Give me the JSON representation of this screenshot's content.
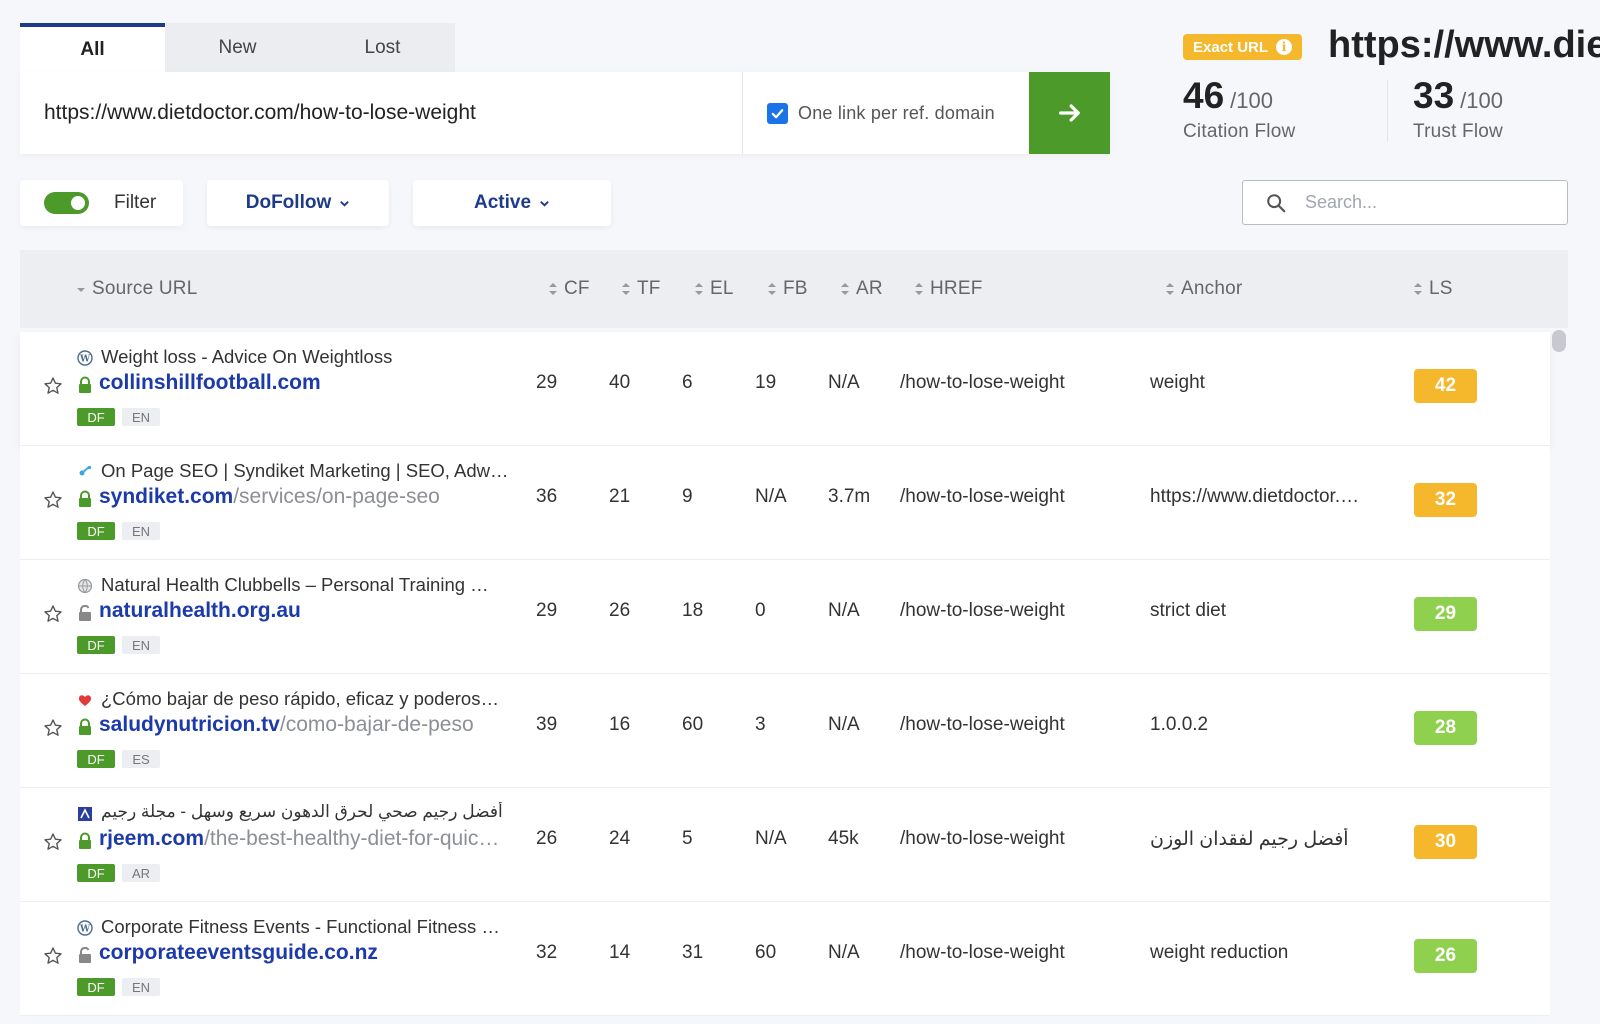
{
  "tabs": [
    {
      "label": "All",
      "active": true
    },
    {
      "label": "New",
      "active": false
    },
    {
      "label": "Lost",
      "active": false
    }
  ],
  "search_bar": {
    "url_value": "https://www.dietdoctor.com/how-to-lose-weight",
    "one_link_label": "One link per ref. domain",
    "one_link_checked": true
  },
  "header": {
    "exact_badge": "Exact URL",
    "target_url": "https://www.dietdoctor.com",
    "citation_flow": {
      "value": "46",
      "max": "/100",
      "label": "Citation Flow"
    },
    "trust_flow": {
      "value": "33",
      "max": "/100",
      "label": "Trust Flow"
    }
  },
  "filters": {
    "filter_label": "Filter",
    "filter_enabled": true,
    "dofollow_label": "DoFollow",
    "active_label": "Active",
    "search_placeholder": "Search..."
  },
  "table": {
    "columns": [
      "Source URL",
      "CF",
      "TF",
      "EL",
      "FB",
      "AR",
      "HREF",
      "Anchor",
      "LS"
    ],
    "rows": [
      {
        "icon": "wordpress-icon",
        "title": "Weight loss - Advice On Weightloss",
        "domain": "collinshillfootball.com",
        "path": "",
        "secure": true,
        "tag": "DF",
        "lang": "EN",
        "cf": "29",
        "tf": "40",
        "el": "6",
        "fb": "19",
        "ar": "N/A",
        "href": "/how-to-lose-weight",
        "anchor": "weight",
        "ls": "42",
        "ls_color": "#f5b72c"
      },
      {
        "icon": "link-icon",
        "title": "On Page SEO | Syndiket Marketing | SEO, Adw…",
        "domain": "syndiket.com",
        "path": "/services/on-page-seo",
        "secure": true,
        "tag": "DF",
        "lang": "EN",
        "cf": "36",
        "tf": "21",
        "el": "9",
        "fb": "N/A",
        "ar": "3.7m",
        "href": "/how-to-lose-weight",
        "anchor": "https://www.dietdoctor.…",
        "ls": "32",
        "ls_color": "#f5b72c"
      },
      {
        "icon": "globe-icon",
        "title": "Natural Health Clubbells – Personal Training …",
        "domain": "naturalhealth.org.au",
        "path": "",
        "secure": false,
        "tag": "DF",
        "lang": "EN",
        "cf": "29",
        "tf": "26",
        "el": "18",
        "fb": "0",
        "ar": "N/A",
        "href": "/how-to-lose-weight",
        "anchor": "strict diet",
        "ls": "29",
        "ls_color": "#8fd14f"
      },
      {
        "icon": "heart-icon",
        "title": "¿Cómo bajar de peso rápido, eficaz y poderos…",
        "domain": "saludynutricion.tv",
        "path": "/como-bajar-de-peso",
        "secure": true,
        "tag": "DF",
        "lang": "ES",
        "cf": "39",
        "tf": "16",
        "el": "60",
        "fb": "3",
        "ar": "N/A",
        "href": "/how-to-lose-weight",
        "anchor": "1.0.0.2",
        "ls": "28",
        "ls_color": "#8fd14f"
      },
      {
        "icon": "fitness-icon",
        "title": "أفضل رجيم صحي لحرق الدهون سريع وسهل - مجلة رجيم",
        "domain": "rjeem.com",
        "path": "/the-best-healthy-diet-for-quic…",
        "secure": true,
        "tag": "DF",
        "lang": "AR",
        "cf": "26",
        "tf": "24",
        "el": "5",
        "fb": "N/A",
        "ar": "45k",
        "href": "/how-to-lose-weight",
        "anchor": "أفضل رجيم لفقدان الوزن",
        "ls": "30",
        "ls_color": "#f5b72c"
      },
      {
        "icon": "wordpress-icon",
        "title": "Corporate Fitness Events - Functional Fitness …",
        "domain": "corporateeventsguide.co.nz",
        "path": "",
        "secure": false,
        "tag": "DF",
        "lang": "EN",
        "cf": "32",
        "tf": "14",
        "el": "31",
        "fb": "60",
        "ar": "N/A",
        "href": "/how-to-lose-weight",
        "anchor": "weight reduction",
        "ls": "26",
        "ls_color": "#8fd14f"
      }
    ]
  },
  "colors": {
    "accent_blue": "#1c3aa9",
    "green": "#4c9a2a",
    "orange": "#f5b72c",
    "light_green": "#8fd14f"
  }
}
